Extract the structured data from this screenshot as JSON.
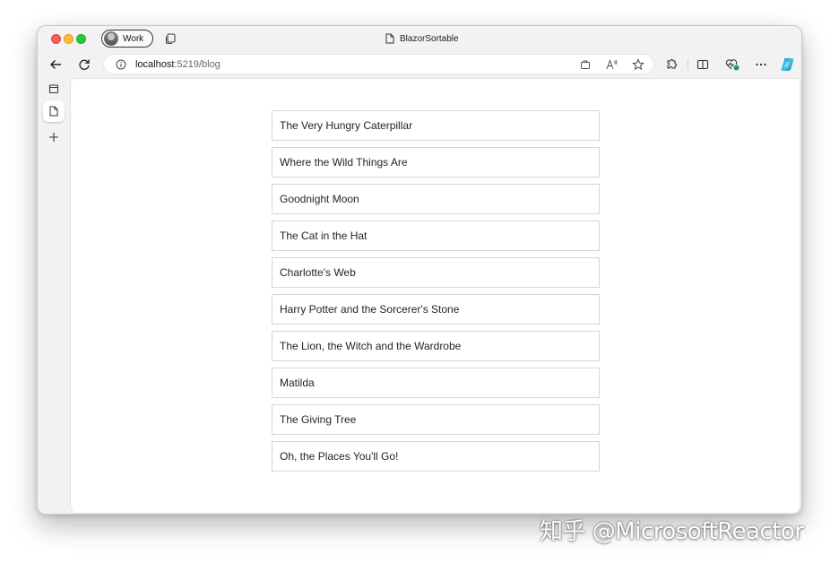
{
  "browser": {
    "profile_label": "Work",
    "tab_title": "BlazorSortable",
    "url_host": "localhost",
    "url_path": ":5219/blog"
  },
  "books": [
    "The Very Hungry Caterpillar",
    "Where the Wild Things Are",
    "Goodnight Moon",
    "The Cat in the Hat",
    "Charlotte's Web",
    "Harry Potter and the Sorcerer's Stone",
    "The Lion, the Witch and the Wardrobe",
    "Matilda",
    "The Giving Tree",
    "Oh, the Places You'll Go!"
  ],
  "watermark": "知乎 @MicrosoftReactor"
}
